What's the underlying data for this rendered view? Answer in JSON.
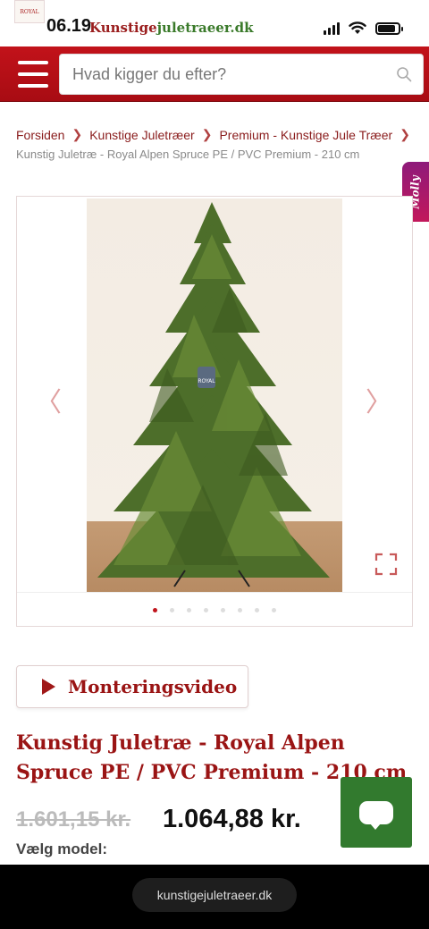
{
  "status_bar": {
    "time": "06.19",
    "brand_prefix": "Kunstige",
    "brand_suffix": "juletraeer.dk",
    "logo_text": "ROYAL"
  },
  "header": {
    "search_placeholder": "Hvad kigger du efter?",
    "menu_icon": "hamburger-icon",
    "search_icon": "search-icon"
  },
  "breadcrumb": {
    "items": [
      "Forsiden",
      "Kunstige Juletræer",
      "Premium - Kunstige Jule Træer"
    ],
    "current": "Kunstig Juletræ - Royal Alpen Spruce PE / PVC Premium - 210 cm"
  },
  "molly_tab": {
    "label": "Molly"
  },
  "gallery": {
    "image_alt": "Kunstig juletræ Royal Alpen Spruce",
    "badge_text": "ROYAL",
    "slide_count": 8,
    "active_slide": 1
  },
  "product": {
    "video_button_label": "Monteringsvideo",
    "title": "Kunstig Juletræ - Royal Alpen Spruce PE / PVC Premium - 210 cm",
    "old_price": "1.601,15 kr.",
    "new_price": "1.064,88 kr.",
    "model_label": "Vælg model:"
  },
  "browser": {
    "url": "kunstigejuletraeer.dk"
  },
  "colors": {
    "brand_red": "#b10f16",
    "title_red": "#9a1414",
    "chat_green": "#327a2e",
    "active_dot": "#c0141c"
  }
}
